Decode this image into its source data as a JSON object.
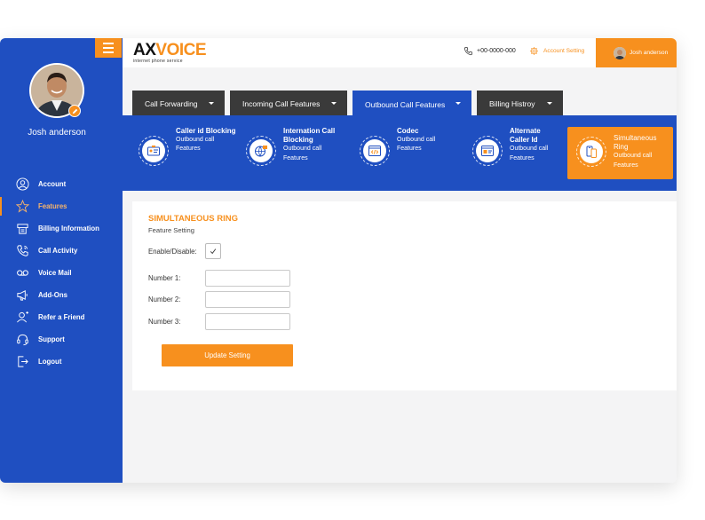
{
  "sidebar": {
    "user_name": "Josh anderson",
    "items": [
      {
        "label": "Account",
        "icon": "user-icon"
      },
      {
        "label": "Features",
        "icon": "star-icon"
      },
      {
        "label": "Billing Information",
        "icon": "billing-icon"
      },
      {
        "label": "Call Activity",
        "icon": "phone-icon"
      },
      {
        "label": "Voice Mail",
        "icon": "voicemail-icon"
      },
      {
        "label": "Add-Ons",
        "icon": "megaphone-icon"
      },
      {
        "label": "Refer a Friend",
        "icon": "refer-icon"
      },
      {
        "label": "Support",
        "icon": "headset-icon"
      },
      {
        "label": "Logout",
        "icon": "logout-icon"
      }
    ],
    "active_item": "Features"
  },
  "header": {
    "logo_ax": "AX",
    "logo_voice": "VOICE",
    "logo_tagline": "internet phone service",
    "phone": "+00-0000-000",
    "account_setting": "Account Setting",
    "user_name": "Josh anderson"
  },
  "tabs": [
    {
      "label": "Call Forwarding"
    },
    {
      "label": "Incoming Call Features"
    },
    {
      "label": "Outbound Call Features"
    },
    {
      "label": "Billing Histroy"
    }
  ],
  "active_tab": "Outbound Call Features",
  "features": [
    {
      "title": "Caller id Blocking",
      "lines": [
        "Outbound call",
        "Features"
      ]
    },
    {
      "title": "Internation Call Blocking",
      "lines": [
        "Outbound call",
        "Features"
      ]
    },
    {
      "title": "Codec",
      "lines": [
        "Outbound call",
        "Features"
      ]
    },
    {
      "title": "Alternate Caller Id",
      "lines": [
        "Outbound call",
        "Features"
      ]
    },
    {
      "title": "Simultaneous Ring",
      "lines": [
        "Outbound call",
        "Features"
      ]
    }
  ],
  "form": {
    "title": "SIMULTANEOUS RING",
    "subtitle": "Feature Setting",
    "enable_label": "Enable/Disable:",
    "enable_checked": true,
    "number1_label": "Number 1:",
    "number2_label": "Number 2:",
    "number3_label": "Number 3:",
    "number1_value": "",
    "number2_value": "",
    "number3_value": "",
    "submit_label": "Update Setting"
  },
  "colors": {
    "primary_blue": "#1f4fc1",
    "accent_orange": "#f7901e",
    "tab_dark": "#3a3a3a"
  }
}
